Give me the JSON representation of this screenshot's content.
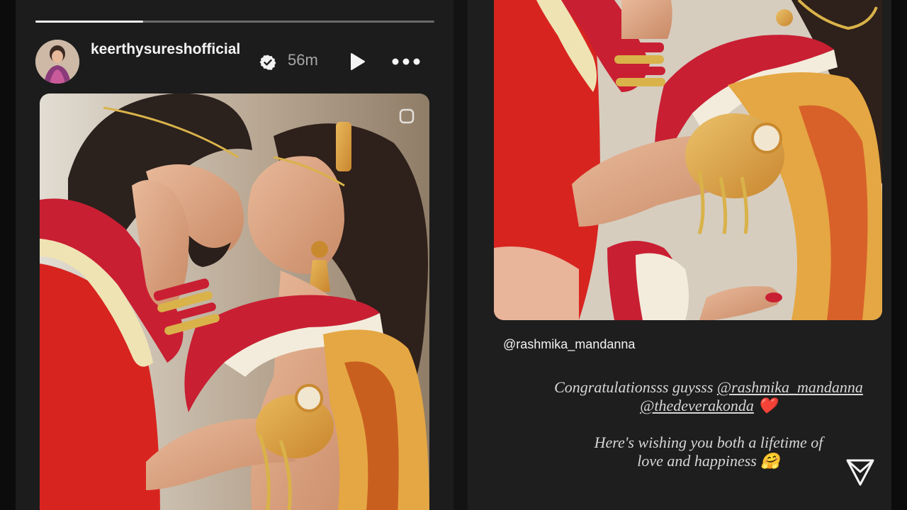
{
  "left_story": {
    "progress": 0.27,
    "username": "keerthysureshofficial",
    "time": "56m",
    "play_label": "Play",
    "more_label": "More options"
  },
  "right_story": {
    "mention": "@rashmika_mandanna",
    "caption": {
      "line1_text": "Congratulationsss guysss",
      "line1_mention": "@rashmika_mandanna",
      "line2_mention": "@thedeverakonda",
      "heart": "❤️",
      "wish_line1": "Here's wishing you both a lifetime of",
      "wish_line2": "love and happiness",
      "emoji": "🤗"
    }
  },
  "colors": {
    "background": "#131313",
    "panel": "#1c1c1c",
    "progress_track": "#6a6a6a",
    "progress_fill": "#f3f3f3",
    "garland_red": "#c91f33",
    "saree_red": "#d8241f",
    "gold": "#d8a23a"
  },
  "icons": {
    "verified": "verified-badge-icon",
    "play": "play-icon",
    "more": "more-horizontal-icon",
    "copy": "carousel-icon",
    "share": "send-icon"
  }
}
